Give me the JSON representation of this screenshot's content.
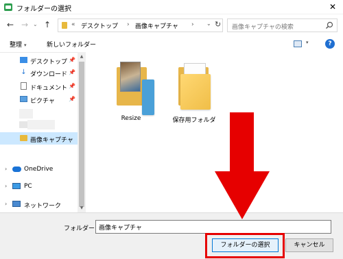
{
  "window": {
    "title": "フォルダーの選択",
    "close_glyph": "✕"
  },
  "nav": {
    "back_glyph": "←",
    "forward_glyph": "→",
    "history_glyph": "⌄",
    "up_glyph": "↑"
  },
  "address": {
    "overflow": "«",
    "parts": [
      "デスクトップ",
      "画像キャプチャ"
    ],
    "separator": "›",
    "dropdown_glyph": "⌄",
    "refresh_glyph": "↻"
  },
  "search": {
    "placeholder": "画像キャプチャの検索"
  },
  "toolbar": {
    "organize_label": "整理",
    "new_folder_label": "新しいフォルダー",
    "dropdown_glyph": "▾",
    "help_glyph": "?"
  },
  "sidebar": {
    "quick_access": [
      {
        "label": "デスクトップ",
        "icon": "desktop-icon",
        "pinned": true
      },
      {
        "label": "ダウンロード",
        "icon": "download-icon",
        "pinned": true
      },
      {
        "label": "ドキュメント",
        "icon": "document-icon",
        "pinned": true
      },
      {
        "label": "ピクチャ",
        "icon": "pictures-icon",
        "pinned": true
      },
      {
        "label": "画像キャプチャ",
        "icon": "folder-icon",
        "selected": true
      }
    ],
    "locations": [
      {
        "label": "OneDrive",
        "icon": "onedrive-icon"
      },
      {
        "label": "PC",
        "icon": "pc-icon"
      },
      {
        "label": "ネットワーク",
        "icon": "network-icon"
      }
    ],
    "pin_glyph": "📌",
    "chevron_glyph": "›"
  },
  "files": [
    {
      "name": "Resize",
      "icon": "folder-with-image-icon"
    },
    {
      "name": "保存用フォルダ",
      "icon": "folder-icon"
    }
  ],
  "footer": {
    "folder_label": "フォルダー:",
    "folder_value": "画像キャプチャ",
    "select_button": "フォルダーの選択",
    "cancel_button": "キャンセル"
  },
  "annotation": {
    "arrow_color": "#e60000",
    "highlight_color": "#e60000"
  }
}
